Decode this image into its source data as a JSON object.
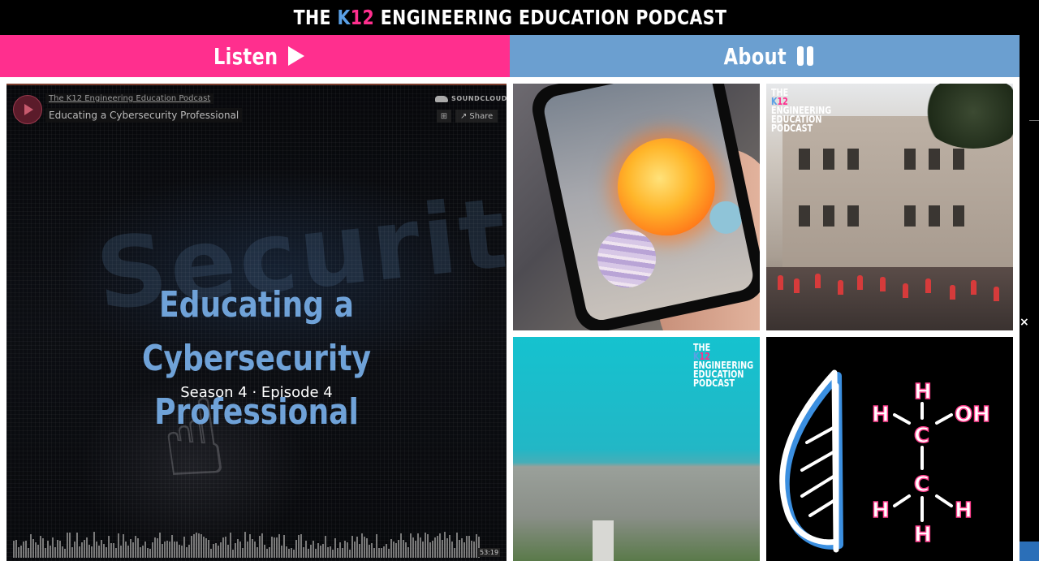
{
  "header": {
    "title_pre": "THE ",
    "title_k": "K",
    "title_12": "12",
    "title_post": " ENGINEERING EDUCATION PODCAST"
  },
  "nav": {
    "listen_label": "Listen",
    "about_label": "About"
  },
  "player": {
    "artist": "The K12 Engineering Education Podcast",
    "track": "Educating a Cybersecurity Professional",
    "brand": "SOUNDCLOUD",
    "share_label": "Share",
    "cart_icon": "cart-icon",
    "cover_title": "Educating a Cybersecurity Professional",
    "cover_subtitle": "Season 4 · Episode 4",
    "duration": "53:19"
  },
  "tiles": {
    "logo_the": "THE",
    "logo_k": "K",
    "logo_12": "12",
    "logo_line2": "ENGINEERING",
    "logo_line3": "EDUCATION",
    "logo_line4": "PODCAST"
  },
  "misc": {
    "close_glyph": "×"
  },
  "colors": {
    "pink": "#ff2f8e",
    "blue": "#6b9fd0",
    "title_blue": "#6fa2d8"
  }
}
